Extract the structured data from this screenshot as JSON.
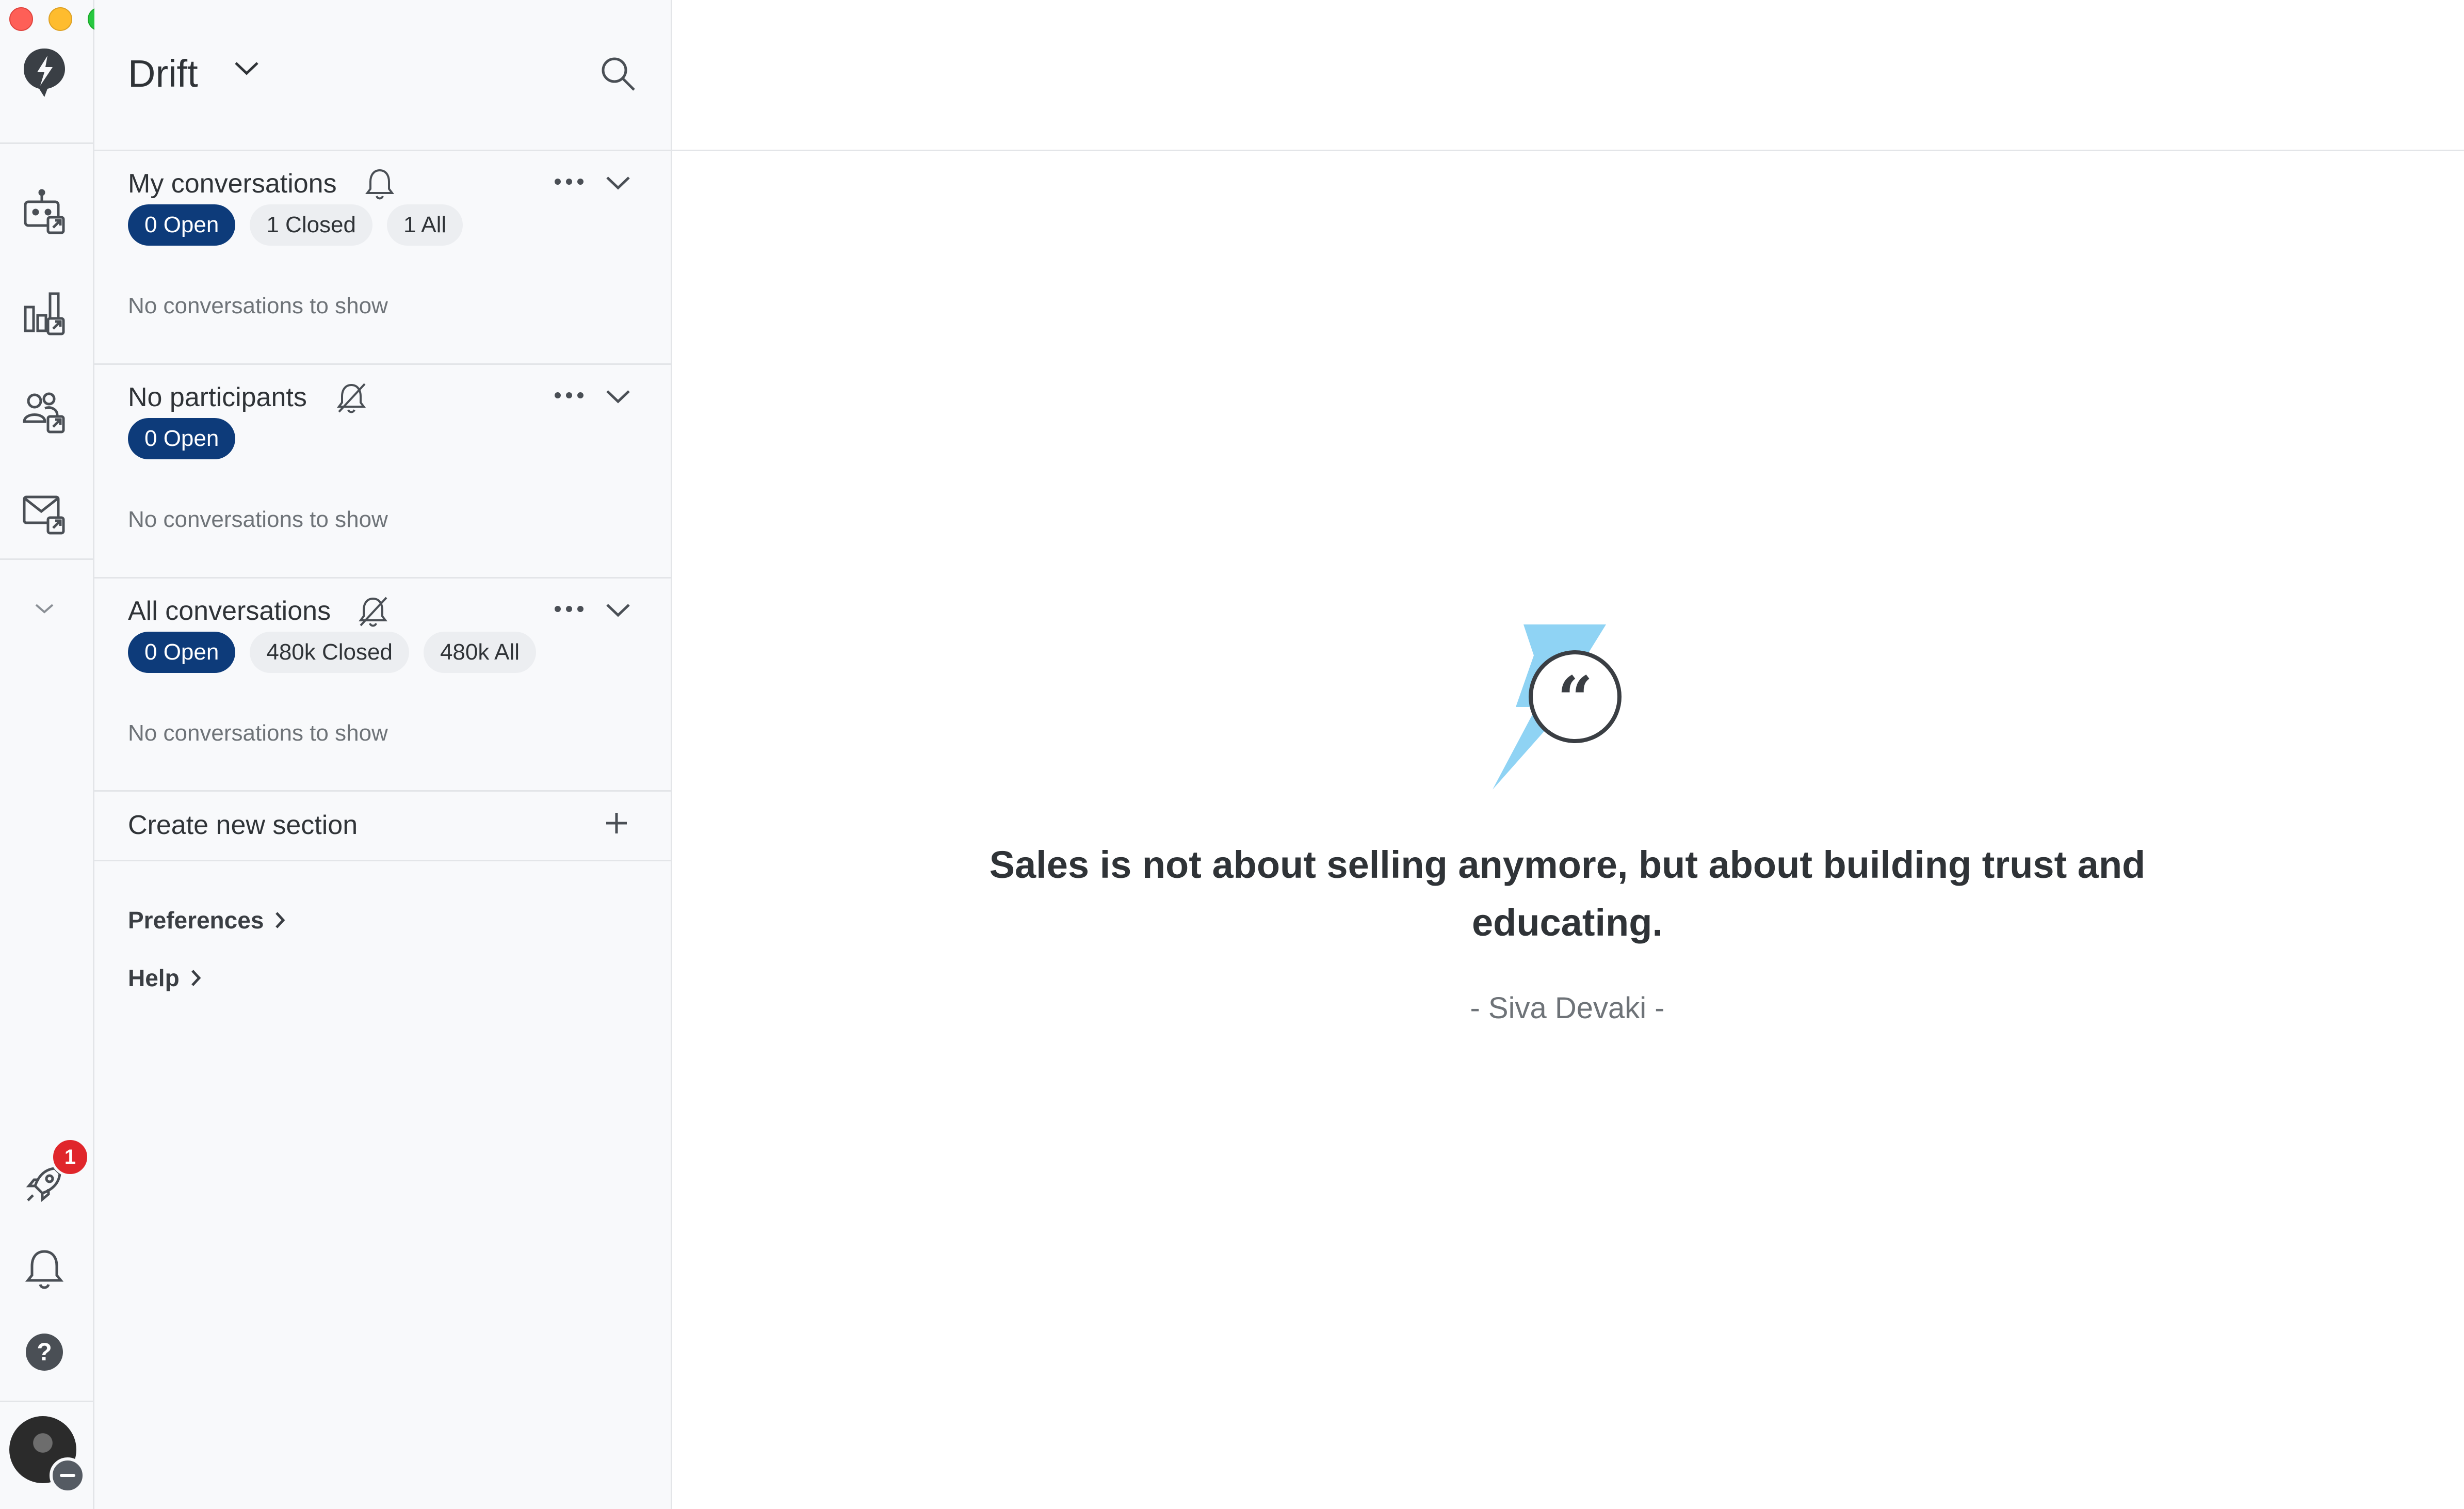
{
  "app": {
    "workspace_name": "Drift"
  },
  "rail": {
    "icons": [
      "drift-logo-icon",
      "bot-icon",
      "reports-icon",
      "contacts-icon",
      "email-icon",
      "chevron-down-icon",
      "rocket-icon",
      "bell-icon",
      "help-icon",
      "avatar"
    ],
    "notification_badge": "1"
  },
  "sections": [
    {
      "title": "My conversations",
      "bell_icon": "bell-icon",
      "pills": [
        "0 Open",
        "1 Closed",
        "1 All"
      ],
      "empty_text": "No conversations to show"
    },
    {
      "title": "No participants",
      "bell_icon": "bell-off-icon",
      "pills": [
        "0 Open"
      ],
      "empty_text": "No conversations to show"
    },
    {
      "title": "All conversations",
      "bell_icon": "bell-off-icon",
      "pills": [
        "0 Open",
        "480k Closed",
        "480k All"
      ],
      "empty_text": "No conversations to show"
    }
  ],
  "create_section": {
    "label": "Create new section"
  },
  "links": {
    "preferences": "Preferences",
    "help": "Help"
  },
  "quote": {
    "text": "Sales is not about selling anymore, but about building trust and educating.",
    "author": "- Siva Devaki -"
  },
  "colors": {
    "accent": "#0d3b7a",
    "badge": "#e0262b",
    "bolt": "#8fd3f4"
  }
}
